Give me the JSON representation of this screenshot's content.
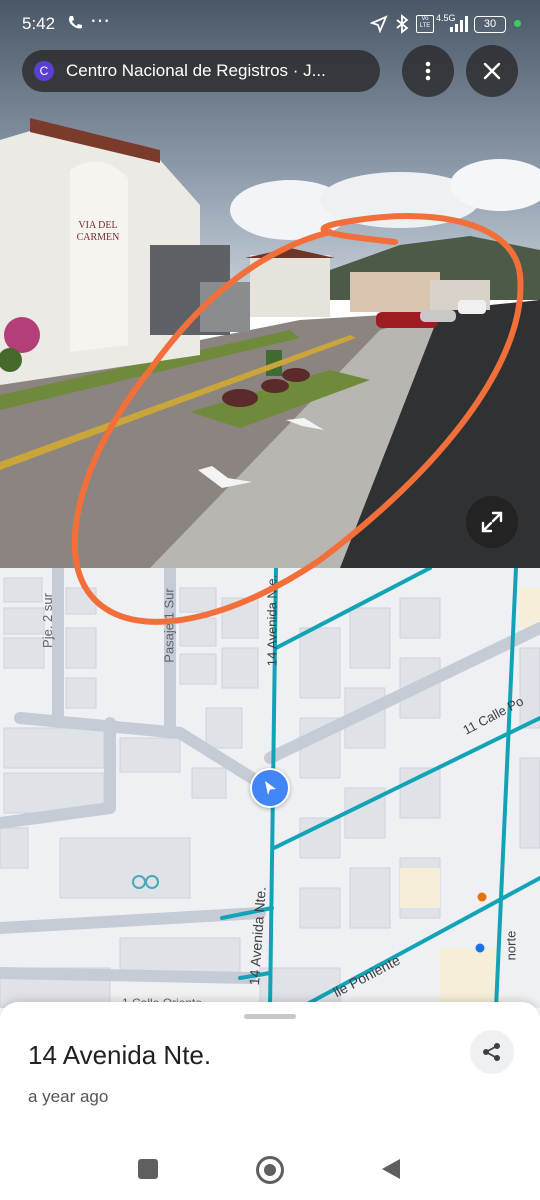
{
  "status_bar": {
    "time": "5:42",
    "icons": [
      "phone-call-icon",
      "more-dots-icon",
      "location-arrow-icon",
      "bluetooth-icon",
      "volte-icon",
      "signal-4g-icon"
    ],
    "network": "4.5G",
    "battery": "30"
  },
  "top_chip": {
    "avatar_letter": "C",
    "title": "Centro Nacional de Registros · J..."
  },
  "panorama": {
    "sign_text_1": "VIA DEL",
    "sign_text_2": "CARMEN"
  },
  "map": {
    "labels": {
      "pje_2_sur": "Pje. 2 sur",
      "pasaje_1_sur": "Pasaje 1 Sur",
      "avenida_top": "14 Avenida Nte.",
      "avenida_bottom": "14 Avenida Nte.",
      "calle_11": "11 Calle Po",
      "calle_poniente": "lle Poniente",
      "norte": "norte",
      "calle_bottom": "1 Calle Oriente"
    },
    "colors": {
      "road": "#13a3b7",
      "marker": "#4285f4",
      "annotation": "#f26f3a"
    }
  },
  "sheet": {
    "title": "14 Avenida Nte.",
    "subtitle": "a year ago"
  },
  "nav": {
    "icons": [
      "recents-square-icon",
      "home-circle-icon",
      "back-triangle-icon"
    ]
  }
}
